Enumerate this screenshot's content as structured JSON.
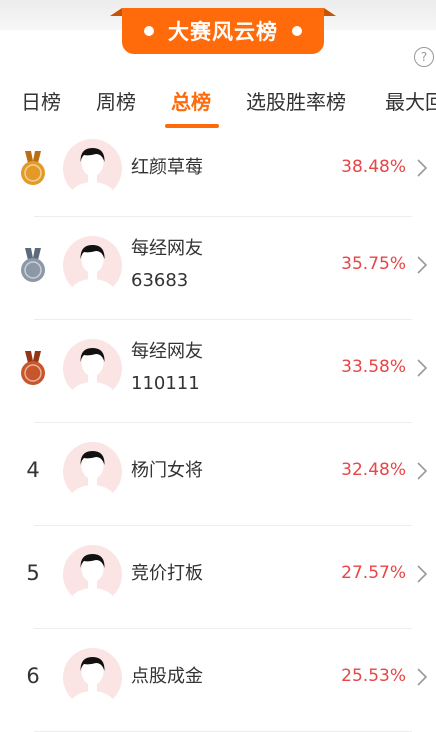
{
  "banner": {
    "title": "大赛风云榜"
  },
  "tabs": [
    {
      "label": "日榜"
    },
    {
      "label": "周榜"
    },
    {
      "label": "总榜"
    },
    {
      "label": "选股胜率榜"
    },
    {
      "label": "最大回"
    }
  ],
  "active_tab": "总榜",
  "help_icon": "question-circle-icon",
  "colors": {
    "accent": "#ff6b0a",
    "percent": "#e84545",
    "gold": "#e39a27",
    "silver": "#8c98a8",
    "bronze": "#c8552b"
  },
  "rankings": [
    {
      "rank": "1",
      "medal": "gold",
      "name_lines": [
        "红颜草莓"
      ],
      "percent": "38.48%"
    },
    {
      "rank": "2",
      "medal": "silver",
      "name_lines": [
        "每经网友",
        "63683"
      ],
      "percent": "35.75%"
    },
    {
      "rank": "3",
      "medal": "bronze",
      "name_lines": [
        "每经网友",
        "110111"
      ],
      "percent": "33.58%"
    },
    {
      "rank": "4",
      "medal": null,
      "name_lines": [
        "杨门女将"
      ],
      "percent": "32.48%"
    },
    {
      "rank": "5",
      "medal": null,
      "name_lines": [
        "竞价打板"
      ],
      "percent": "27.57%"
    },
    {
      "rank": "6",
      "medal": null,
      "name_lines": [
        "点股成金"
      ],
      "percent": "25.53%"
    }
  ]
}
